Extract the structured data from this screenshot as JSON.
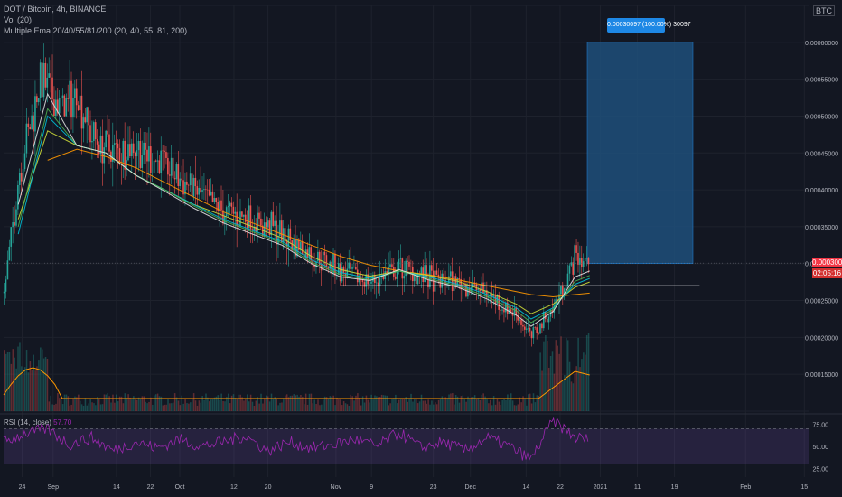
{
  "header": {
    "symbol_line": "DOT / Bitcoin, 4h, BINANCE",
    "volume_line": "Vol (20)",
    "ema_line": "Multiple Ema 20/40/55/81/200 (20, 40, 55, 81, 200)",
    "currency_label": "BTC"
  },
  "rsi_header": {
    "label": "RSI (14, close)",
    "value": "57.70"
  },
  "position_tool": {
    "label": "0.00030097 (100.00%) 30097",
    "target_price": 0.0006,
    "entry_price": 0.0003
  },
  "price_tag": "0.00030067",
  "countdown": "02:05:16",
  "colors": {
    "background": "#131722",
    "up": "#26a69a",
    "down": "#ef5350",
    "ema20": "#e0e0e0",
    "ema40": "#4caf50",
    "ema55": "#00bcd4",
    "ema81": "#cddc39",
    "ema200": "#ff9800",
    "rsi": "#9c27b0",
    "volume_ma": "#ff9800",
    "position_fill": "#1e4f7a",
    "price_tag": "#f23645"
  },
  "chart_data": [
    {
      "type": "line",
      "title": "DOT / Bitcoin, 4h, BINANCE",
      "ylim": [
        0.0001,
        0.00065
      ],
      "y_ticks": [
        "0.00065000",
        "0.00060000",
        "0.00055000",
        "0.00050000",
        "0.00045000",
        "0.00040000",
        "0.00035000",
        "0.00030000",
        "0.00025000",
        "0.00020000",
        "0.00015000",
        "0.00010000"
      ],
      "x_ticks": [
        "24",
        "Sep",
        "14",
        "22",
        "Oct",
        "12",
        "20",
        "Nov",
        "9",
        "23",
        "Dec",
        "14",
        "22",
        "2021",
        "11",
        "19",
        "Feb",
        "15"
      ],
      "series": [
        {
          "kind": "price_close",
          "x": [
            0,
            2,
            5,
            8,
            10,
            12,
            15,
            18,
            22,
            26,
            30,
            34,
            38,
            42,
            46,
            50,
            54,
            58,
            62,
            66,
            70,
            72,
            75,
            78,
            80
          ],
          "values": [
            0.00026,
            0.00042,
            0.00055,
            0.00051,
            0.00053,
            0.00047,
            0.00045,
            0.00046,
            0.00043,
            0.0004,
            0.00037,
            0.00036,
            0.00034,
            0.00031,
            0.00029,
            0.000275,
            0.000295,
            0.00028,
            0.000275,
            0.00026,
            0.00023,
            0.0002,
            0.00024,
            0.00031,
            0.0003
          ]
        },
        {
          "kind": "ema200",
          "x": [
            6,
            10,
            14,
            18,
            22,
            26,
            30,
            34,
            38,
            42,
            46,
            50,
            54,
            58,
            62,
            66,
            70,
            72,
            75,
            78,
            80
          ],
          "values": [
            0.00044,
            0.000455,
            0.000445,
            0.00043,
            0.00041,
            0.00039,
            0.00037,
            0.000355,
            0.00034,
            0.000325,
            0.00031,
            0.000298,
            0.00029,
            0.000285,
            0.000278,
            0.00027,
            0.000262,
            0.000258,
            0.000255,
            0.000258,
            0.00026
          ]
        },
        {
          "kind": "ema81",
          "x": [
            2,
            6,
            10,
            14,
            18,
            22,
            26,
            30,
            34,
            38,
            42,
            46,
            50,
            54,
            58,
            62,
            66,
            70,
            72,
            75,
            78,
            80
          ],
          "values": [
            0.00036,
            0.00048,
            0.00046,
            0.00045,
            0.00042,
            0.0004,
            0.00038,
            0.000365,
            0.00035,
            0.000335,
            0.00031,
            0.000292,
            0.000283,
            0.00029,
            0.000284,
            0.000276,
            0.000262,
            0.000245,
            0.000232,
            0.000245,
            0.000268,
            0.000275
          ]
        },
        {
          "kind": "ema55",
          "x": [
            2,
            6,
            10,
            14,
            18,
            22,
            26,
            30,
            34,
            38,
            42,
            46,
            50,
            54,
            58,
            62,
            66,
            70,
            72,
            75,
            78,
            80
          ],
          "values": [
            0.00034,
            0.0005,
            0.00046,
            0.00045,
            0.00042,
            0.0004,
            0.00038,
            0.00036,
            0.000345,
            0.00033,
            0.000305,
            0.000288,
            0.00028,
            0.00029,
            0.000282,
            0.000272,
            0.000258,
            0.00024,
            0.000225,
            0.00024,
            0.000272,
            0.00028
          ]
        },
        {
          "kind": "ema40",
          "x": [
            2,
            6,
            10,
            14,
            18,
            22,
            26,
            30,
            34,
            38,
            42,
            46,
            50,
            54,
            58,
            62,
            66,
            70,
            72,
            75,
            78,
            80
          ],
          "values": [
            0.00035,
            0.00051,
            0.00046,
            0.00045,
            0.00042,
            0.0004,
            0.000378,
            0.000358,
            0.000343,
            0.000328,
            0.000302,
            0.000285,
            0.000278,
            0.00029,
            0.00028,
            0.00027,
            0.000255,
            0.000236,
            0.00022,
            0.000238,
            0.000276,
            0.000284
          ]
        },
        {
          "kind": "ema20",
          "x": [
            2,
            6,
            10,
            14,
            18,
            22,
            26,
            30,
            34,
            38,
            42,
            46,
            50,
            54,
            58,
            62,
            66,
            70,
            72,
            75,
            78,
            80
          ],
          "values": [
            0.00038,
            0.00053,
            0.00046,
            0.00045,
            0.00042,
            0.000398,
            0.000375,
            0.000355,
            0.00034,
            0.000325,
            0.0003,
            0.000282,
            0.000277,
            0.000292,
            0.000278,
            0.000268,
            0.000252,
            0.00023,
            0.000215,
            0.000235,
            0.000282,
            0.00029
          ]
        }
      ],
      "horizontal_line": {
        "from_x": 46,
        "to_x": 95,
        "value": 0.00027
      },
      "current_price": 0.00030067
    },
    {
      "type": "line",
      "title": "RSI (14, close)",
      "ylim": [
        15,
        85
      ],
      "y_ticks": [
        "75.00",
        "50.00",
        "25.00"
      ],
      "bands": [
        70,
        30
      ],
      "series": [
        {
          "name": "RSI",
          "x": [
            0,
            3,
            6,
            9,
            12,
            15,
            18,
            21,
            24,
            27,
            30,
            33,
            36,
            39,
            42,
            45,
            48,
            51,
            54,
            57,
            60,
            63,
            66,
            69,
            72,
            75,
            78,
            80
          ],
          "values": [
            55,
            65,
            70,
            52,
            60,
            45,
            55,
            48,
            58,
            50,
            55,
            62,
            45,
            55,
            48,
            52,
            58,
            50,
            66,
            48,
            55,
            45,
            60,
            50,
            35,
            80,
            60,
            58
          ]
        }
      ]
    }
  ]
}
